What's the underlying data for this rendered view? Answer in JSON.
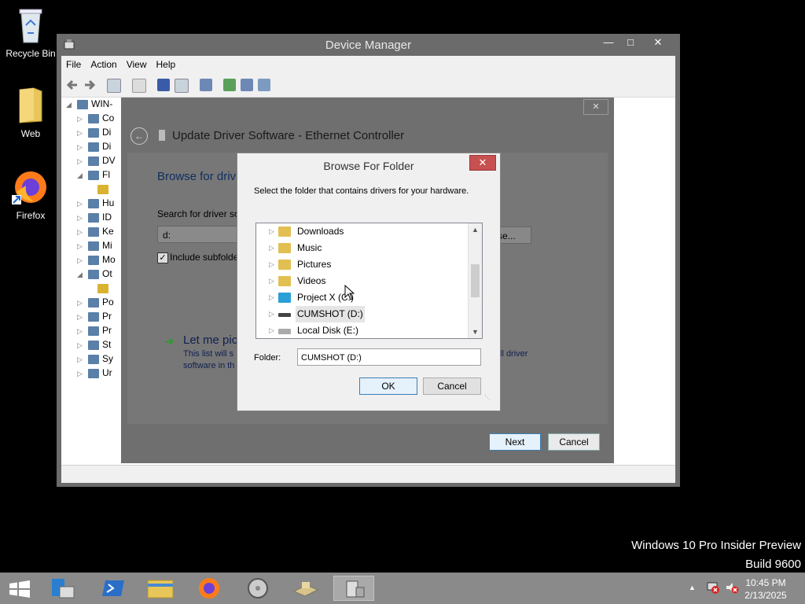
{
  "desktop": {
    "icons": [
      {
        "label": "Recycle Bin"
      },
      {
        "label": "Web"
      },
      {
        "label": "Firefox"
      }
    ],
    "watermark_line1": "Windows 10 Pro Insider Preview",
    "watermark_line2": "Build 9600"
  },
  "device_manager": {
    "title": "Device Manager",
    "menu": [
      "File",
      "Action",
      "View",
      "Help"
    ],
    "tree_root": "WIN-",
    "tree_items": [
      "Co",
      "Di",
      "Di",
      "DV",
      "Fl",
      "",
      "Hu",
      "ID",
      "Ke",
      "Mi",
      "Mo",
      "Ot",
      "",
      "Po",
      "Pr",
      "Pr",
      "St",
      "Sy",
      "Ur"
    ]
  },
  "wizard": {
    "title": "Update Driver Software - Ethernet Controller",
    "heading": "Browse for driv",
    "search_label": "Search for driver so",
    "path_value": "d:",
    "browse_label": "se...",
    "include_subfolders": "Include subfolde",
    "let_me_pick": "Let me pic",
    "list_text_1": "This list will s",
    "list_text_1b": "ll driver",
    "list_text_2": "software in th",
    "next": "Next",
    "cancel": "Cancel"
  },
  "browse_folder": {
    "title": "Browse For Folder",
    "description": "Select the folder that contains drivers for your hardware.",
    "items": [
      {
        "label": "Downloads",
        "icon": "downloads-folder-icon"
      },
      {
        "label": "Music",
        "icon": "music-folder-icon"
      },
      {
        "label": "Pictures",
        "icon": "pictures-folder-icon"
      },
      {
        "label": "Videos",
        "icon": "videos-folder-icon"
      },
      {
        "label": "Project X (C:)",
        "icon": "windows-drive-icon"
      },
      {
        "label": "CUMSHOT (D:)",
        "icon": "optical-drive-icon",
        "selected": true
      },
      {
        "label": "Local Disk (E:)",
        "icon": "hard-drive-icon"
      }
    ],
    "folder_label": "Folder:",
    "folder_value": "CUMSHOT (D:)",
    "ok": "OK",
    "cancel": "Cancel"
  },
  "taskbar": {
    "time": "10:45 PM",
    "date": "2/13/2025"
  }
}
